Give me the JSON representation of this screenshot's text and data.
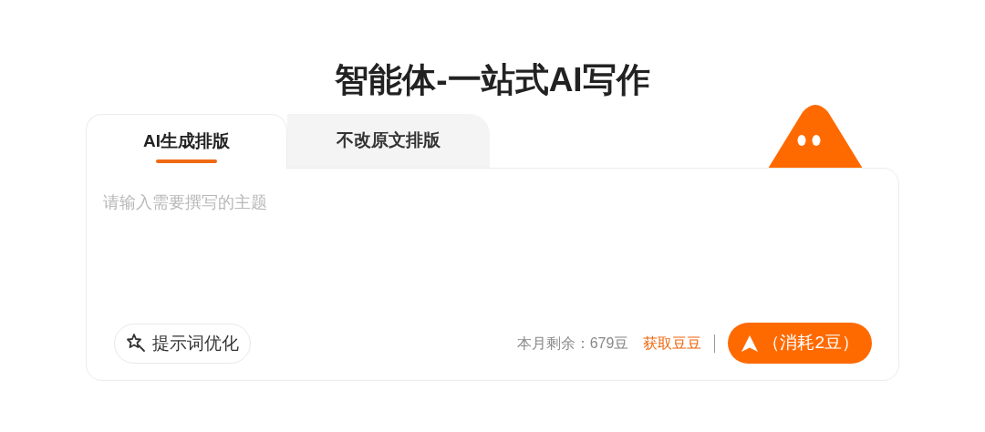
{
  "title": "智能体-一站式AI写作",
  "tabs": [
    {
      "label": "AI生成排版",
      "selected": true
    },
    {
      "label": "不改原文排版",
      "selected": false
    }
  ],
  "topic_field": {
    "placeholder": "请输入需要撰写的主题"
  },
  "optimize_button": {
    "label": "提示词优化"
  },
  "balance": "本月剩余：679豆",
  "get_beans_link": "获取豆豆",
  "submit_button": {
    "label": "（消耗2豆）"
  }
}
